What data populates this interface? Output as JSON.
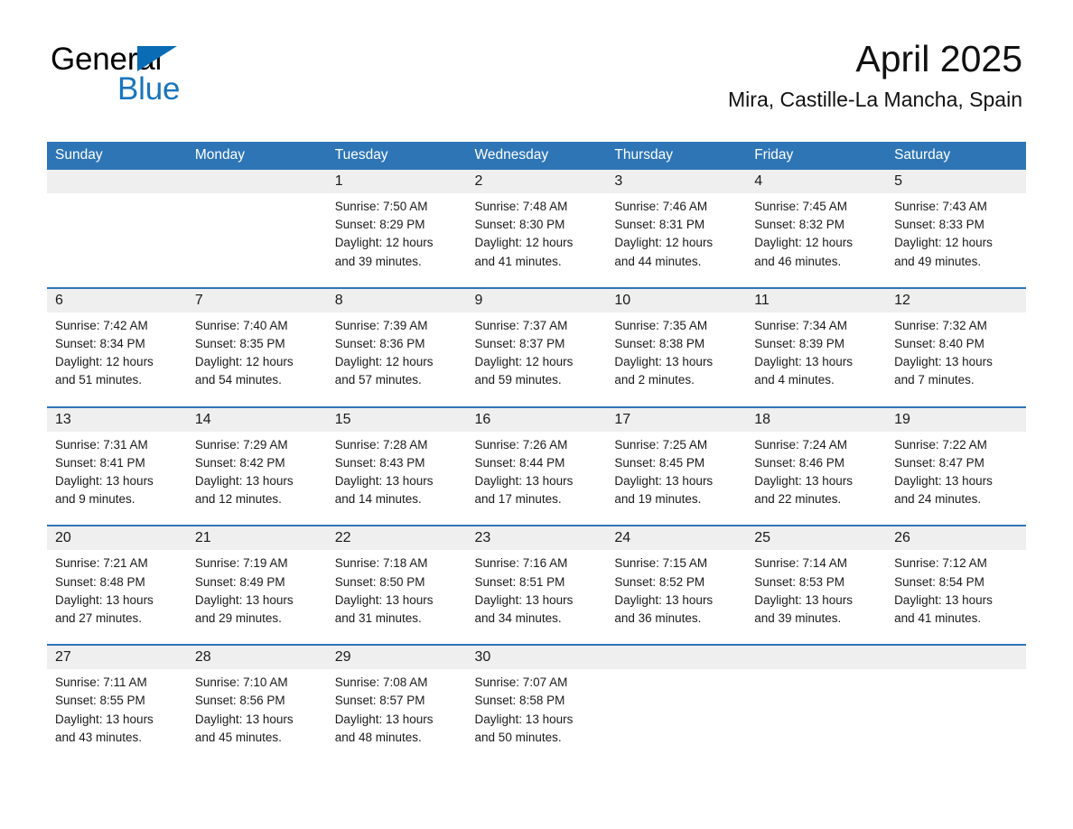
{
  "brand": {
    "word_one": "General",
    "word_two": "Blue",
    "flag_icon": "triangle-flag-icon",
    "blue": "#1a75bc",
    "dark_blue": "#0a6cb4"
  },
  "header": {
    "month_title": "April 2025",
    "location": "Mira, Castille-La Mancha, Spain"
  },
  "theme": {
    "header_blue": "#2e75b6",
    "daynum_band": "#efefef",
    "text": "#1a1a1a"
  },
  "weekdays": [
    "Sunday",
    "Monday",
    "Tuesday",
    "Wednesday",
    "Thursday",
    "Friday",
    "Saturday"
  ],
  "weeks": [
    {
      "rule": false,
      "days": [
        {
          "num": "",
          "l1": "",
          "l2": "",
          "l3": "",
          "l4": ""
        },
        {
          "num": "",
          "l1": "",
          "l2": "",
          "l3": "",
          "l4": ""
        },
        {
          "num": "1",
          "l1": "Sunrise: 7:50 AM",
          "l2": "Sunset: 8:29 PM",
          "l3": "Daylight: 12 hours",
          "l4": "and 39 minutes."
        },
        {
          "num": "2",
          "l1": "Sunrise: 7:48 AM",
          "l2": "Sunset: 8:30 PM",
          "l3": "Daylight: 12 hours",
          "l4": "and 41 minutes."
        },
        {
          "num": "3",
          "l1": "Sunrise: 7:46 AM",
          "l2": "Sunset: 8:31 PM",
          "l3": "Daylight: 12 hours",
          "l4": "and 44 minutes."
        },
        {
          "num": "4",
          "l1": "Sunrise: 7:45 AM",
          "l2": "Sunset: 8:32 PM",
          "l3": "Daylight: 12 hours",
          "l4": "and 46 minutes."
        },
        {
          "num": "5",
          "l1": "Sunrise: 7:43 AM",
          "l2": "Sunset: 8:33 PM",
          "l3": "Daylight: 12 hours",
          "l4": "and 49 minutes."
        }
      ]
    },
    {
      "rule": true,
      "days": [
        {
          "num": "6",
          "l1": "Sunrise: 7:42 AM",
          "l2": "Sunset: 8:34 PM",
          "l3": "Daylight: 12 hours",
          "l4": "and 51 minutes."
        },
        {
          "num": "7",
          "l1": "Sunrise: 7:40 AM",
          "l2": "Sunset: 8:35 PM",
          "l3": "Daylight: 12 hours",
          "l4": "and 54 minutes."
        },
        {
          "num": "8",
          "l1": "Sunrise: 7:39 AM",
          "l2": "Sunset: 8:36 PM",
          "l3": "Daylight: 12 hours",
          "l4": "and 57 minutes."
        },
        {
          "num": "9",
          "l1": "Sunrise: 7:37 AM",
          "l2": "Sunset: 8:37 PM",
          "l3": "Daylight: 12 hours",
          "l4": "and 59 minutes."
        },
        {
          "num": "10",
          "l1": "Sunrise: 7:35 AM",
          "l2": "Sunset: 8:38 PM",
          "l3": "Daylight: 13 hours",
          "l4": "and 2 minutes."
        },
        {
          "num": "11",
          "l1": "Sunrise: 7:34 AM",
          "l2": "Sunset: 8:39 PM",
          "l3": "Daylight: 13 hours",
          "l4": "and 4 minutes."
        },
        {
          "num": "12",
          "l1": "Sunrise: 7:32 AM",
          "l2": "Sunset: 8:40 PM",
          "l3": "Daylight: 13 hours",
          "l4": "and 7 minutes."
        }
      ]
    },
    {
      "rule": true,
      "days": [
        {
          "num": "13",
          "l1": "Sunrise: 7:31 AM",
          "l2": "Sunset: 8:41 PM",
          "l3": "Daylight: 13 hours",
          "l4": "and 9 minutes."
        },
        {
          "num": "14",
          "l1": "Sunrise: 7:29 AM",
          "l2": "Sunset: 8:42 PM",
          "l3": "Daylight: 13 hours",
          "l4": "and 12 minutes."
        },
        {
          "num": "15",
          "l1": "Sunrise: 7:28 AM",
          "l2": "Sunset: 8:43 PM",
          "l3": "Daylight: 13 hours",
          "l4": "and 14 minutes."
        },
        {
          "num": "16",
          "l1": "Sunrise: 7:26 AM",
          "l2": "Sunset: 8:44 PM",
          "l3": "Daylight: 13 hours",
          "l4": "and 17 minutes."
        },
        {
          "num": "17",
          "l1": "Sunrise: 7:25 AM",
          "l2": "Sunset: 8:45 PM",
          "l3": "Daylight: 13 hours",
          "l4": "and 19 minutes."
        },
        {
          "num": "18",
          "l1": "Sunrise: 7:24 AM",
          "l2": "Sunset: 8:46 PM",
          "l3": "Daylight: 13 hours",
          "l4": "and 22 minutes."
        },
        {
          "num": "19",
          "l1": "Sunrise: 7:22 AM",
          "l2": "Sunset: 8:47 PM",
          "l3": "Daylight: 13 hours",
          "l4": "and 24 minutes."
        }
      ]
    },
    {
      "rule": true,
      "days": [
        {
          "num": "20",
          "l1": "Sunrise: 7:21 AM",
          "l2": "Sunset: 8:48 PM",
          "l3": "Daylight: 13 hours",
          "l4": "and 27 minutes."
        },
        {
          "num": "21",
          "l1": "Sunrise: 7:19 AM",
          "l2": "Sunset: 8:49 PM",
          "l3": "Daylight: 13 hours",
          "l4": "and 29 minutes."
        },
        {
          "num": "22",
          "l1": "Sunrise: 7:18 AM",
          "l2": "Sunset: 8:50 PM",
          "l3": "Daylight: 13 hours",
          "l4": "and 31 minutes."
        },
        {
          "num": "23",
          "l1": "Sunrise: 7:16 AM",
          "l2": "Sunset: 8:51 PM",
          "l3": "Daylight: 13 hours",
          "l4": "and 34 minutes."
        },
        {
          "num": "24",
          "l1": "Sunrise: 7:15 AM",
          "l2": "Sunset: 8:52 PM",
          "l3": "Daylight: 13 hours",
          "l4": "and 36 minutes."
        },
        {
          "num": "25",
          "l1": "Sunrise: 7:14 AM",
          "l2": "Sunset: 8:53 PM",
          "l3": "Daylight: 13 hours",
          "l4": "and 39 minutes."
        },
        {
          "num": "26",
          "l1": "Sunrise: 7:12 AM",
          "l2": "Sunset: 8:54 PM",
          "l3": "Daylight: 13 hours",
          "l4": "and 41 minutes."
        }
      ]
    },
    {
      "rule": true,
      "days": [
        {
          "num": "27",
          "l1": "Sunrise: 7:11 AM",
          "l2": "Sunset: 8:55 PM",
          "l3": "Daylight: 13 hours",
          "l4": "and 43 minutes."
        },
        {
          "num": "28",
          "l1": "Sunrise: 7:10 AM",
          "l2": "Sunset: 8:56 PM",
          "l3": "Daylight: 13 hours",
          "l4": "and 45 minutes."
        },
        {
          "num": "29",
          "l1": "Sunrise: 7:08 AM",
          "l2": "Sunset: 8:57 PM",
          "l3": "Daylight: 13 hours",
          "l4": "and 48 minutes."
        },
        {
          "num": "30",
          "l1": "Sunrise: 7:07 AM",
          "l2": "Sunset: 8:58 PM",
          "l3": "Daylight: 13 hours",
          "l4": "and 50 minutes."
        },
        {
          "num": "",
          "l1": "",
          "l2": "",
          "l3": "",
          "l4": ""
        },
        {
          "num": "",
          "l1": "",
          "l2": "",
          "l3": "",
          "l4": ""
        },
        {
          "num": "",
          "l1": "",
          "l2": "",
          "l3": "",
          "l4": ""
        }
      ]
    }
  ]
}
